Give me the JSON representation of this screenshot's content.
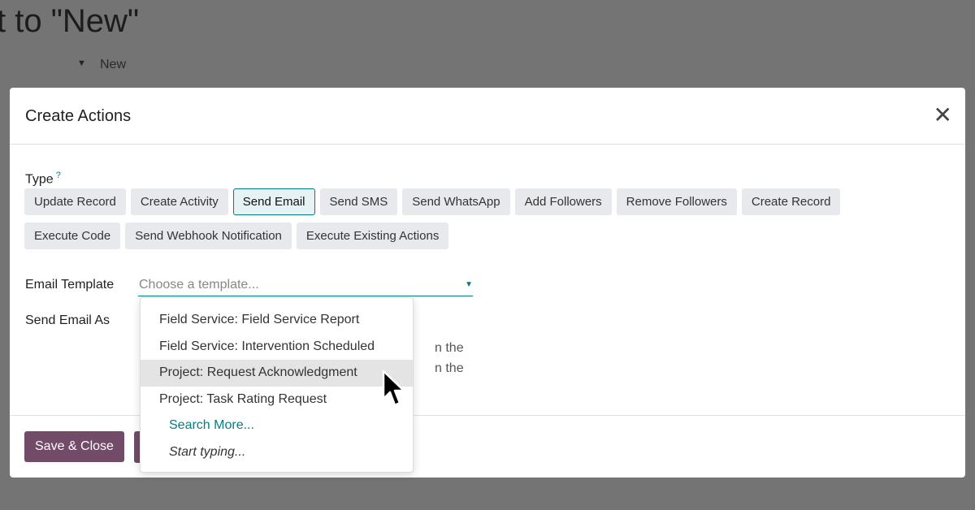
{
  "background": {
    "title": "t to \"New\"",
    "status": "New"
  },
  "modal": {
    "title": "Create Actions",
    "type_label": "Type",
    "help": "?",
    "types": [
      {
        "label": "Update Record",
        "selected": false
      },
      {
        "label": "Create Activity",
        "selected": false
      },
      {
        "label": "Send Email",
        "selected": true
      },
      {
        "label": "Send SMS",
        "selected": false
      },
      {
        "label": "Send WhatsApp",
        "selected": false
      },
      {
        "label": "Add Followers",
        "selected": false
      },
      {
        "label": "Remove Followers",
        "selected": false
      },
      {
        "label": "Create Record",
        "selected": false
      },
      {
        "label": "Execute Code",
        "selected": false
      },
      {
        "label": "Send Webhook Notification",
        "selected": false
      },
      {
        "label": "Execute Existing Actions",
        "selected": false
      }
    ],
    "email_template_label": "Email Template",
    "email_template_placeholder": "Choose a template...",
    "send_as_label": "Send Email As",
    "partial_lines": [
      "n the",
      "n the"
    ],
    "save_label": "Save & Close"
  },
  "dropdown": {
    "options": [
      "Field Service: Field Service Report",
      "Field Service: Intervention Scheduled",
      "Project: Request Acknowledgment",
      "Project: Task Rating Request"
    ],
    "highlighted_index": 2,
    "search_more": "Search More...",
    "start_typing": "Start typing..."
  },
  "colors": {
    "accent": "#017e84",
    "primary": "#714b67",
    "overlay": "#747474"
  }
}
